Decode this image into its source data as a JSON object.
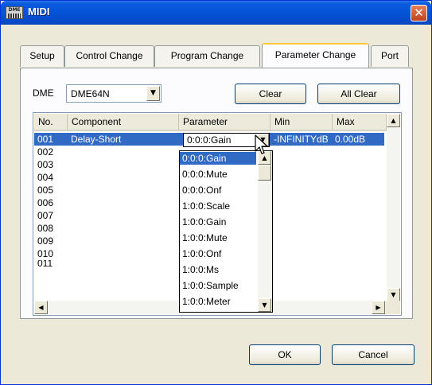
{
  "window": {
    "title": "MIDI",
    "icon_text": "DME",
    "accent": "#0a5adf",
    "close_color": "#d8532b"
  },
  "tabs": [
    {
      "label": "Setup",
      "active": false
    },
    {
      "label": "Control Change",
      "active": false
    },
    {
      "label": "Program Change",
      "active": false
    },
    {
      "label": "Parameter Change",
      "active": true
    },
    {
      "label": "Port",
      "active": false
    }
  ],
  "dme": {
    "label": "DME",
    "selected": "DME64N"
  },
  "buttons": {
    "clear": "Clear",
    "all_clear": "All Clear",
    "ok": "OK",
    "cancel": "Cancel"
  },
  "table": {
    "columns": [
      "No.",
      "Component",
      "Parameter",
      "Min",
      "Max"
    ],
    "rows": [
      {
        "no": "001",
        "component": "Delay-Short",
        "parameter": "0:0:0:Gain",
        "min": "-INFINITYdB",
        "max": "0.00dB",
        "selected": true
      },
      {
        "no": "002"
      },
      {
        "no": "003"
      },
      {
        "no": "004"
      },
      {
        "no": "005"
      },
      {
        "no": "006"
      },
      {
        "no": "007"
      },
      {
        "no": "008"
      },
      {
        "no": "009"
      },
      {
        "no": "010"
      },
      {
        "no": "011"
      }
    ]
  },
  "parameter_dropdown": {
    "current": "0:0:0:Gain",
    "options": [
      "0:0:0:Gain",
      "0:0:0:Mute",
      "0:0:0:Onf",
      "1:0:0:Scale",
      "1:0:0:Gain",
      "1:0:0:Mute",
      "1:0:0:Onf",
      "1:0:0:Ms",
      "1:0:0:Sample",
      "1:0:0:Meter"
    ],
    "highlighted_index": 0,
    "highlight_color": "#316ac5"
  },
  "icons": {
    "dropdown": "chevron-down-icon",
    "scroll_up": "arrow-up-icon",
    "scroll_down": "arrow-down-icon",
    "scroll_left": "arrow-left-icon",
    "scroll_right": "arrow-right-icon",
    "close": "close-icon",
    "cursor": "mouse-pointer-icon"
  }
}
